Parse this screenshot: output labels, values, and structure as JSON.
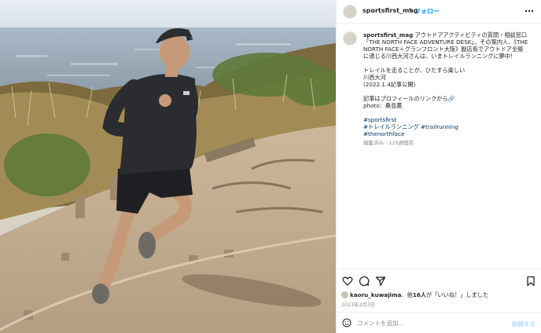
{
  "post": {
    "username": "sportsfirst_mag",
    "separator": "•",
    "follow_label": "フォロー"
  },
  "caption": {
    "username": "sportsfirst_mag",
    "lines": [
      "アウトドアアクティビティの質問・相談窓口",
      "「THE NORTH FACE ADVENTURE DESK」。その案内人、《THE",
      "NORTH FACE＋グランフロント大阪》副店長でアウトドア全般",
      "に通じる川西大河さんは、いまトレイルランニングに夢中！"
    ],
    "para2": [
      "トレイルを走ることが、ひたすら楽しい",
      "川西大河",
      "(2022.1.4記事公開)"
    ],
    "para3": [
      "記事はプロフィールのリンクから🔗",
      "photo：桑島薫"
    ],
    "hashtags": [
      "#sportsfirst",
      "#トレイルランニング #trailrunning",
      "#thenorthface"
    ],
    "meta": "編集済み · 129週間前"
  },
  "likes": {
    "user": "kaoru_kuwajima",
    "text_mid": "、他",
    "count": "16人",
    "text_end": "が「いいね！」しました"
  },
  "date": "2023年2月3日",
  "comment": {
    "placeholder": "コメントを追加...",
    "post_label": "投稿する"
  },
  "icons": {
    "more": "more-horizontal-icon",
    "like": "heart-icon",
    "comment": "comment-bubble-icon",
    "share": "send-icon",
    "save": "bookmark-icon",
    "emoji": "emoji-icon"
  },
  "colors": {
    "link": "#0095f6",
    "hashtag": "#00376b",
    "muted": "#8e8e8e",
    "post_button_disabled": "#b2dffc"
  }
}
